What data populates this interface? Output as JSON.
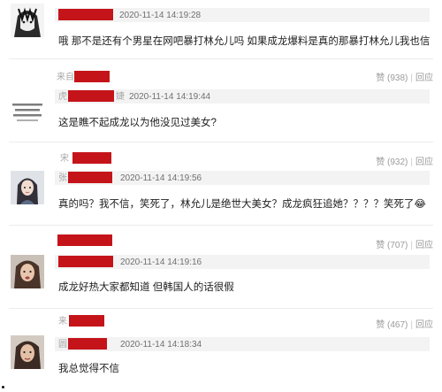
{
  "comments": [
    {
      "time": "2020-11-14 14:19:28",
      "text": "哦 那不是还有个男星在网吧暴打林允儿吗 如果成龙爆料是真的那暴打林允儿我也信",
      "avatar_text": "",
      "prefix": "",
      "suffix": "",
      "likes": "",
      "reply": ""
    },
    {
      "time": "2020-11-14 14:19:44",
      "text": "这是瞧不起成龙以为他没见过美女?",
      "avatar_text": "",
      "prefix": "来自",
      "suffix": "婕",
      "likes": "赞 (938)",
      "reply": "回应"
    },
    {
      "time": "2020-11-14 14:19:56",
      "text": "真的吗？我不信，笑死了，林允儿是绝世大美女？成龙疯狂追她？？？？笑死了😂",
      "avatar_text": "",
      "prefix": "",
      "suffix": "",
      "likes": "赞 (932)",
      "reply": "回应"
    },
    {
      "time": "2020-11-14 14:19:16",
      "text": "成龙好热大家都知道 但韩国人的话很假",
      "avatar_text": "",
      "prefix": "",
      "suffix": "",
      "likes": "赞 (707)",
      "reply": "回应"
    },
    {
      "time": "2020-11-14 14:18:34",
      "text": "我总觉得不信",
      "avatar_text": "",
      "prefix": "",
      "suffix": "",
      "likes": "赞 (467)",
      "reply": "回应"
    }
  ],
  "colors": {
    "redaction": "#c4141a",
    "meta_bar": "#f3f3f3",
    "muted_text": "#9a9a9a"
  }
}
